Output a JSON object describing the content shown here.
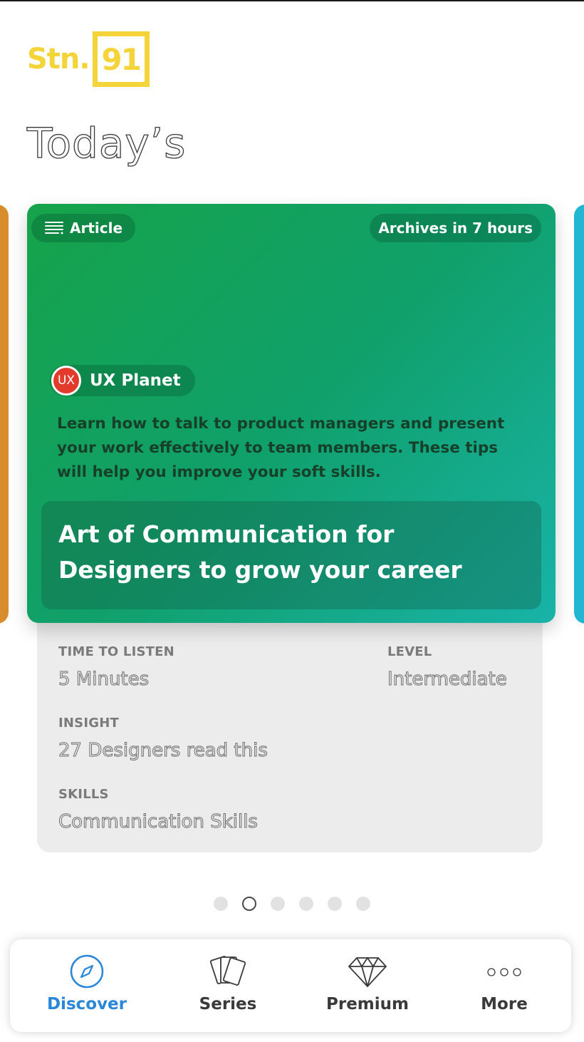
{
  "brand": {
    "logo_text": "Stn.",
    "logo_number": "91",
    "color": "#f5d43a"
  },
  "heading": "Today’s",
  "card": {
    "type_label": "Article",
    "type_icon": "text-lines-icon",
    "archive_label": "Archives in 7 hours",
    "source": {
      "badge": "UX",
      "name": "UX Planet"
    },
    "description": "Learn how to talk to product managers and present your work effectively to team members. These tips will help you improve your soft skills.",
    "title": "Art of Communication for Designers to grow your career",
    "gradient": [
      "#16a34a",
      "#18b3a8"
    ]
  },
  "details": {
    "time_label": "TIME TO LISTEN",
    "time_value": "5 Minutes",
    "level_label": "LEVEL",
    "level_value": "Intermediate",
    "insight_label": "INSIGHT",
    "insight_value": "27 Designers read this",
    "skills_label": "SKILLS",
    "skills_value": "Communication Skills"
  },
  "pagination": {
    "total": 6,
    "active_index": 1
  },
  "nav": {
    "items": [
      {
        "label": "Discover",
        "icon": "compass-icon",
        "active": true
      },
      {
        "label": "Series",
        "icon": "cards-icon",
        "active": false
      },
      {
        "label": "Premium",
        "icon": "diamond-icon",
        "active": false
      },
      {
        "label": "More",
        "icon": "more-dots-icon",
        "active": false
      }
    ],
    "active_color": "#2a86d9"
  }
}
